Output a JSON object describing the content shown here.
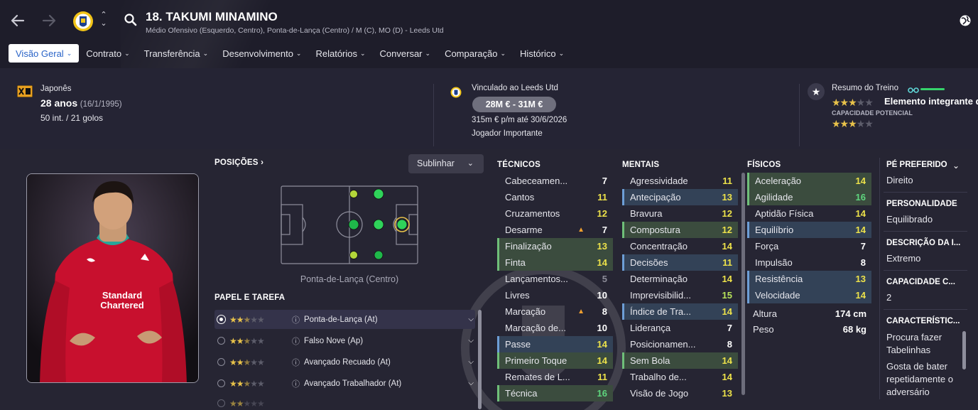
{
  "header": {
    "title": "18. TAKUMI MINAMINO",
    "subtitle": "Médio Ofensivo (Esquerdo, Centro), Ponta-de-Lança (Centro) / M (C), MO (D) - Leeds Utd"
  },
  "tabs": [
    {
      "label": "Visão Geral"
    },
    {
      "label": "Contrato"
    },
    {
      "label": "Transferência"
    },
    {
      "label": "Desenvolvimento"
    },
    {
      "label": "Relatórios"
    },
    {
      "label": "Conversar"
    },
    {
      "label": "Comparação"
    },
    {
      "label": "Histórico"
    }
  ],
  "info": {
    "nationality": "Japonês",
    "age": "28 anos",
    "dob": "(16/1/1995)",
    "caps": "50 int. / 21 golos",
    "contract_label": "Vinculado ao Leeds Utd",
    "value_range": "28M € - 31M €",
    "wage": "315m € p/m até 30/6/2026",
    "squad_status": "Jogador Importante",
    "training_label": "Resumo do Treino",
    "training_text": "Elemento integrante d",
    "current_ability_stars": 3,
    "potential_label": "CAPACIDADE POTENCIAL",
    "potential_stars": 3
  },
  "positions": {
    "heading": "POSIÇÕES",
    "position_name": "Ponta-de-Lança (Centro)",
    "highlight_label": "Sublinhar"
  },
  "roles": {
    "heading": "PAPEL E TAREFA",
    "items": [
      {
        "name": "Ponta-de-Lança (At)",
        "stars": 2.5,
        "selected": true
      },
      {
        "name": "Falso Nove (Ap)",
        "stars": 2.5,
        "selected": false
      },
      {
        "name": "Avançado Recuado (At)",
        "stars": 2.5,
        "selected": false
      },
      {
        "name": "Avançado Trabalhador (At)",
        "stars": 2.5,
        "selected": false
      }
    ]
  },
  "attributes": {
    "tecnicos_heading": "TÉCNICOS",
    "tecnicos": [
      {
        "name": "Cabeceamen...",
        "value": "7",
        "hl": ""
      },
      {
        "name": "Cantos",
        "value": "11",
        "hl": ""
      },
      {
        "name": "Cruzamentos",
        "value": "12",
        "hl": ""
      },
      {
        "name": "Desarme",
        "value": "7",
        "hl": "",
        "arrow": true
      },
      {
        "name": "Finalização",
        "value": "13",
        "hl": "green"
      },
      {
        "name": "Finta",
        "value": "14",
        "hl": "green"
      },
      {
        "name": "Lançamentos...",
        "value": "5",
        "hl": ""
      },
      {
        "name": "Livres",
        "value": "10",
        "hl": ""
      },
      {
        "name": "Marcação",
        "value": "8",
        "hl": "",
        "arrow": true
      },
      {
        "name": "Marcação de...",
        "value": "10",
        "hl": ""
      },
      {
        "name": "Passe",
        "value": "14",
        "hl": "blue"
      },
      {
        "name": "Primeiro Toque",
        "value": "14",
        "hl": "green"
      },
      {
        "name": "Remates de L...",
        "value": "11",
        "hl": ""
      },
      {
        "name": "Técnica",
        "value": "16",
        "hl": "green"
      }
    ],
    "mentais_heading": "MENTAIS",
    "mentais": [
      {
        "name": "Agressividade",
        "value": "11",
        "hl": ""
      },
      {
        "name": "Antecipação",
        "value": "13",
        "hl": "blue"
      },
      {
        "name": "Bravura",
        "value": "12",
        "hl": ""
      },
      {
        "name": "Compostura",
        "value": "12",
        "hl": "green"
      },
      {
        "name": "Concentração",
        "value": "14",
        "hl": ""
      },
      {
        "name": "Decisões",
        "value": "11",
        "hl": "blue"
      },
      {
        "name": "Determinação",
        "value": "14",
        "hl": ""
      },
      {
        "name": "Imprevisibilid...",
        "value": "15",
        "hl": ""
      },
      {
        "name": "Índice de Tra...",
        "value": "14",
        "hl": "blue"
      },
      {
        "name": "Liderança",
        "value": "7",
        "hl": ""
      },
      {
        "name": "Posicionamen...",
        "value": "8",
        "hl": ""
      },
      {
        "name": "Sem Bola",
        "value": "14",
        "hl": "green"
      },
      {
        "name": "Trabalho de...",
        "value": "14",
        "hl": ""
      },
      {
        "name": "Visão de Jogo",
        "value": "13",
        "hl": ""
      }
    ],
    "fisicos_heading": "FÍSICOS",
    "fisicos": [
      {
        "name": "Aceleração",
        "value": "14",
        "hl": "green"
      },
      {
        "name": "Agilidade",
        "value": "16",
        "hl": "green"
      },
      {
        "name": "Aptidão Física",
        "value": "14",
        "hl": ""
      },
      {
        "name": "Equilíbrio",
        "value": "14",
        "hl": "blue"
      },
      {
        "name": "Força",
        "value": "7",
        "hl": ""
      },
      {
        "name": "Impulsão",
        "value": "8",
        "hl": ""
      },
      {
        "name": "Resistência",
        "value": "13",
        "hl": "blue"
      },
      {
        "name": "Velocidade",
        "value": "14",
        "hl": "blue"
      }
    ],
    "height_label": "Altura",
    "height_value": "174 cm",
    "weight_label": "Peso",
    "weight_value": "68 kg"
  },
  "side": {
    "foot_label": "PÉ PREFERIDO",
    "foot_value": "Direito",
    "personality_label": "PERSONALIDADE",
    "personality_value": "Equilibrado",
    "description_label": "DESCRIÇÃO DA I...",
    "description_value": "Extremo",
    "capacity_label": "CAPACIDADE C...",
    "capacity_value": "2",
    "traits_label": "CARACTERÍSTIC...",
    "traits": [
      "Procura fazer Tabelinhas",
      "Gosta de bater repetidamente o adversário"
    ]
  },
  "photo_text": {
    "sponsor": "Standard Chartered"
  },
  "colors": {
    "accent": "#2a64c8",
    "star": "#e8c24a",
    "highlight_green": "#3b4c3e",
    "highlight_blue": "#334257",
    "value_yellow": "#ede24a",
    "value_green": "#5fd67e"
  }
}
